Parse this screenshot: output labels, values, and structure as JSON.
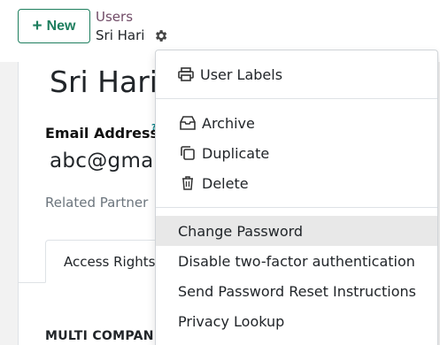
{
  "control_panel": {
    "new_button_label": "New",
    "breadcrumb_parent": "Users",
    "breadcrumb_current": "Sri Hari"
  },
  "form": {
    "user_name": "Sri Hari",
    "email_label": "Email Address",
    "help_mark": "?",
    "email_value": "abc@gmail.com",
    "related_partner_label": "Related Partner",
    "tab_access_rights": "Access Rights",
    "section_multi_company": "MULTI COMPANIES"
  },
  "action_menu": {
    "user_labels": "User Labels",
    "archive": "Archive",
    "duplicate": "Duplicate",
    "delete": "Delete",
    "change_password": "Change Password",
    "disable_2fa": "Disable two-factor authentication",
    "send_reset": "Send Password Reset Instructions",
    "privacy_lookup": "Privacy Lookup"
  },
  "colors": {
    "brand_green": "#1e7e5e",
    "breadcrumb_purple": "#714b67",
    "hover_bg": "#e8e8e8"
  },
  "icons": [
    "plus-icon",
    "gear-icon",
    "print-icon",
    "archive-icon",
    "duplicate-icon",
    "trash-icon"
  ]
}
